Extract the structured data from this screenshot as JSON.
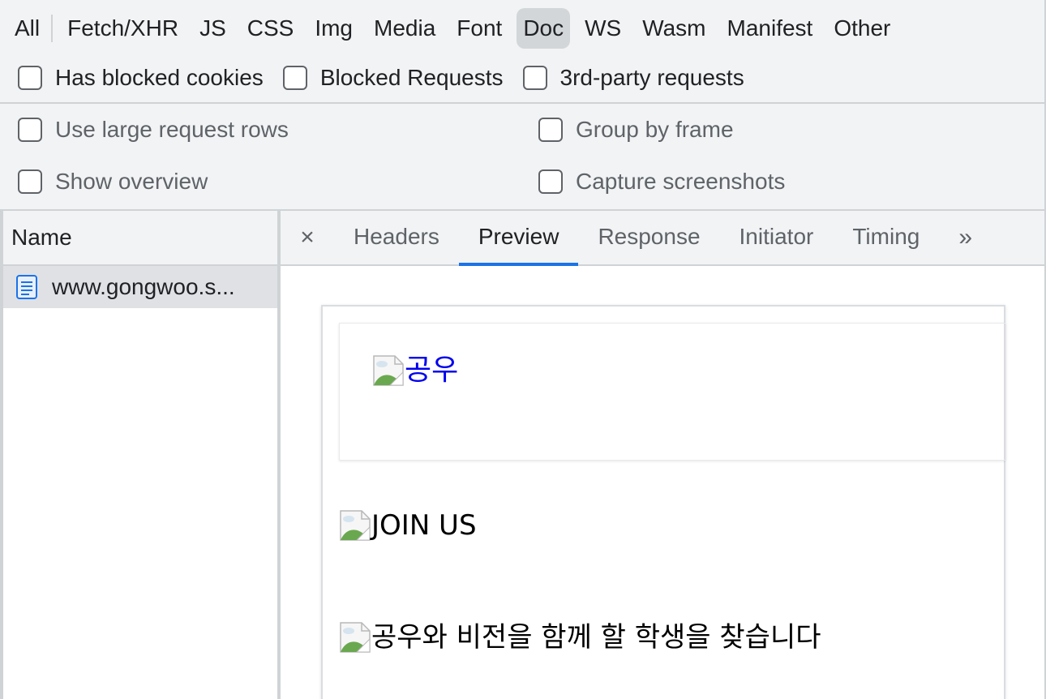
{
  "filters": {
    "types": [
      "All",
      "Fetch/XHR",
      "JS",
      "CSS",
      "Img",
      "Media",
      "Font",
      "Doc",
      "WS",
      "Wasm",
      "Manifest",
      "Other"
    ],
    "active_type": "Doc",
    "checkboxes": [
      "Has blocked cookies",
      "Blocked Requests",
      "3rd-party requests"
    ]
  },
  "settings": {
    "large_rows": "Use large request rows",
    "group_by_frame": "Group by frame",
    "show_overview": "Show overview",
    "capture_screenshots": "Capture screenshots"
  },
  "requests": {
    "header": "Name",
    "items": [
      {
        "name": "www.gongwoo.s..."
      }
    ]
  },
  "details": {
    "close": "×",
    "tabs": [
      "Headers",
      "Preview",
      "Response",
      "Initiator",
      "Timing"
    ],
    "active_tab": "Preview",
    "more": "»"
  },
  "preview": {
    "logo_alt": "공우",
    "join_alt": "JOIN US",
    "tagline_alt": "공우와 비전을 함께 할 학생을 찾습니다"
  },
  "colors": {
    "accent": "#1a73e8",
    "link": "#0000ee",
    "toolbar_bg": "#f1f3f4",
    "selected_row": "#dfe1e5"
  }
}
